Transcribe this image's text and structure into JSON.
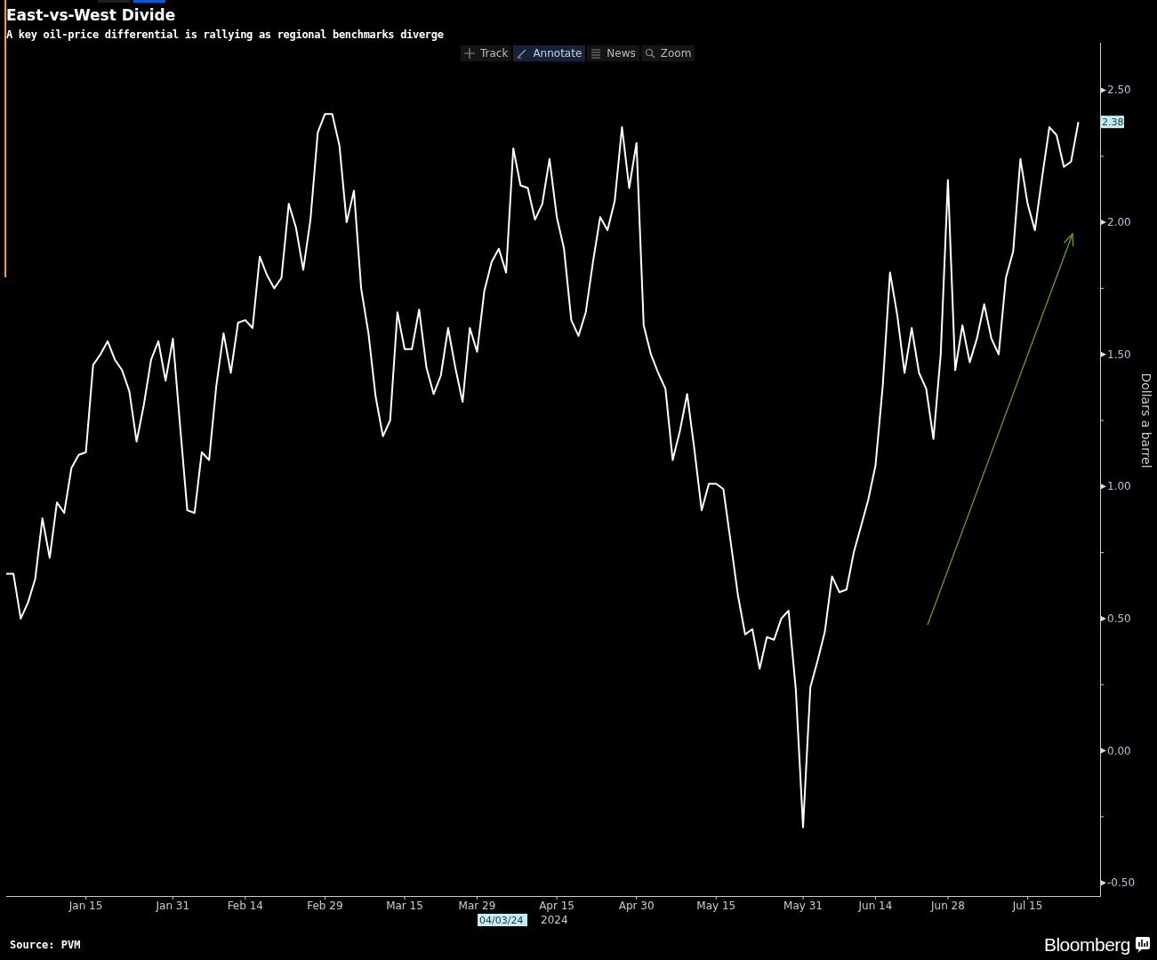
{
  "header": {
    "title": "East-vs-West Divide",
    "subtitle": "A key oil-price differential is rallying as regional benchmarks diverge"
  },
  "toolbar": [
    {
      "label": "Track",
      "selected": false
    },
    {
      "label": "Annotate",
      "selected": true
    },
    {
      "label": "News",
      "selected": false
    },
    {
      "label": "Zoom",
      "selected": false
    }
  ],
  "chart": {
    "last_value_label": "2.38",
    "cursor_date_label": "04/03/24",
    "year_label": "2024",
    "chart_data": {
      "type": "line",
      "ylabel": "Dollars a barrel",
      "categories": [
        null,
        null,
        null,
        null,
        null,
        null,
        null,
        null,
        null,
        null,
        null,
        "Jan 15",
        null,
        null,
        null,
        null,
        null,
        null,
        null,
        null,
        null,
        null,
        null,
        "Jan 31",
        null,
        null,
        null,
        null,
        null,
        null,
        null,
        null,
        null,
        "Feb 14",
        null,
        null,
        null,
        null,
        null,
        null,
        null,
        null,
        null,
        null,
        "Feb 29",
        null,
        null,
        null,
        null,
        null,
        null,
        null,
        null,
        null,
        null,
        "Mar 15",
        null,
        null,
        null,
        null,
        null,
        null,
        null,
        null,
        null,
        "Mar 29",
        null,
        null,
        null,
        null,
        null,
        null,
        null,
        null,
        null,
        null,
        "Apr 15",
        null,
        null,
        null,
        null,
        null,
        null,
        null,
        null,
        null,
        null,
        "Apr 30",
        null,
        null,
        null,
        null,
        null,
        null,
        null,
        null,
        null,
        null,
        "May 15",
        null,
        null,
        null,
        null,
        null,
        null,
        null,
        null,
        null,
        null,
        null,
        "May 31",
        null,
        null,
        null,
        null,
        null,
        null,
        null,
        null,
        null,
        "Jun 14",
        null,
        null,
        null,
        null,
        null,
        null,
        null,
        null,
        null,
        "Jun 28",
        null,
        null,
        null,
        null,
        null,
        null,
        null,
        null,
        null,
        null,
        "Jul 15",
        null,
        null,
        null,
        null,
        null,
        null,
        null
      ],
      "ylim": [
        -0.55,
        2.68
      ],
      "yticks": [
        {
          "value": 2.5,
          "label": "2.50"
        },
        {
          "value": 2,
          "label": "2.00"
        },
        {
          "value": 1.5,
          "label": "1.50"
        },
        {
          "value": 1,
          "label": "1.00"
        },
        {
          "value": 0.5,
          "label": "0.50"
        },
        {
          "value": 0,
          "label": "0.00"
        },
        {
          "value": -0.5,
          "label": "-0.50"
        }
      ],
      "series": [
        {
          "color": "#ffffff",
          "values": [
            0.67,
            0.67,
            0.5,
            0.56,
            0.65,
            0.88,
            0.73,
            0.94,
            0.9,
            1.07,
            1.12,
            1.13,
            1.46,
            1.5,
            1.55,
            1.48,
            1.44,
            1.36,
            1.17,
            1.31,
            1.48,
            1.55,
            1.4,
            1.56,
            1.23,
            0.91,
            0.9,
            1.13,
            1.1,
            1.38,
            1.58,
            1.43,
            1.62,
            1.63,
            1.6,
            1.87,
            1.8,
            1.75,
            1.79,
            2.07,
            1.98,
            1.82,
            2.01,
            2.34,
            2.41,
            2.41,
            2.29,
            2.0,
            2.12,
            1.75,
            1.58,
            1.34,
            1.19,
            1.25,
            1.66,
            1.52,
            1.52,
            1.67,
            1.45,
            1.35,
            1.42,
            1.6,
            1.45,
            1.32,
            1.6,
            1.51,
            1.74,
            1.85,
            1.9,
            1.81,
            2.28,
            2.14,
            2.13,
            2.01,
            2.07,
            2.24,
            2.02,
            1.9,
            1.63,
            1.57,
            1.66,
            1.85,
            2.02,
            1.97,
            2.08,
            2.36,
            2.13,
            2.3,
            1.61,
            1.5,
            1.43,
            1.37,
            1.1,
            1.21,
            1.35,
            1.14,
            0.91,
            1.01,
            1.01,
            0.99,
            0.79,
            0.59,
            0.44,
            0.46,
            0.31,
            0.43,
            0.42,
            0.5,
            0.53,
            0.23,
            -0.29,
            0.24,
            0.34,
            0.45,
            0.66,
            0.6,
            0.61,
            0.75,
            0.85,
            0.95,
            1.08,
            1.38,
            1.81,
            1.65,
            1.43,
            1.6,
            1.43,
            1.37,
            1.18,
            1.5,
            2.16,
            1.44,
            1.61,
            1.47,
            1.56,
            1.69,
            1.56,
            1.5,
            1.79,
            1.89,
            2.24,
            2.07,
            1.97,
            2.17,
            2.36,
            2.33,
            2.21,
            2.23,
            2.38
          ]
        }
      ]
    }
  },
  "footer": {
    "source": "Source: PVM",
    "brand": "Bloomberg"
  }
}
